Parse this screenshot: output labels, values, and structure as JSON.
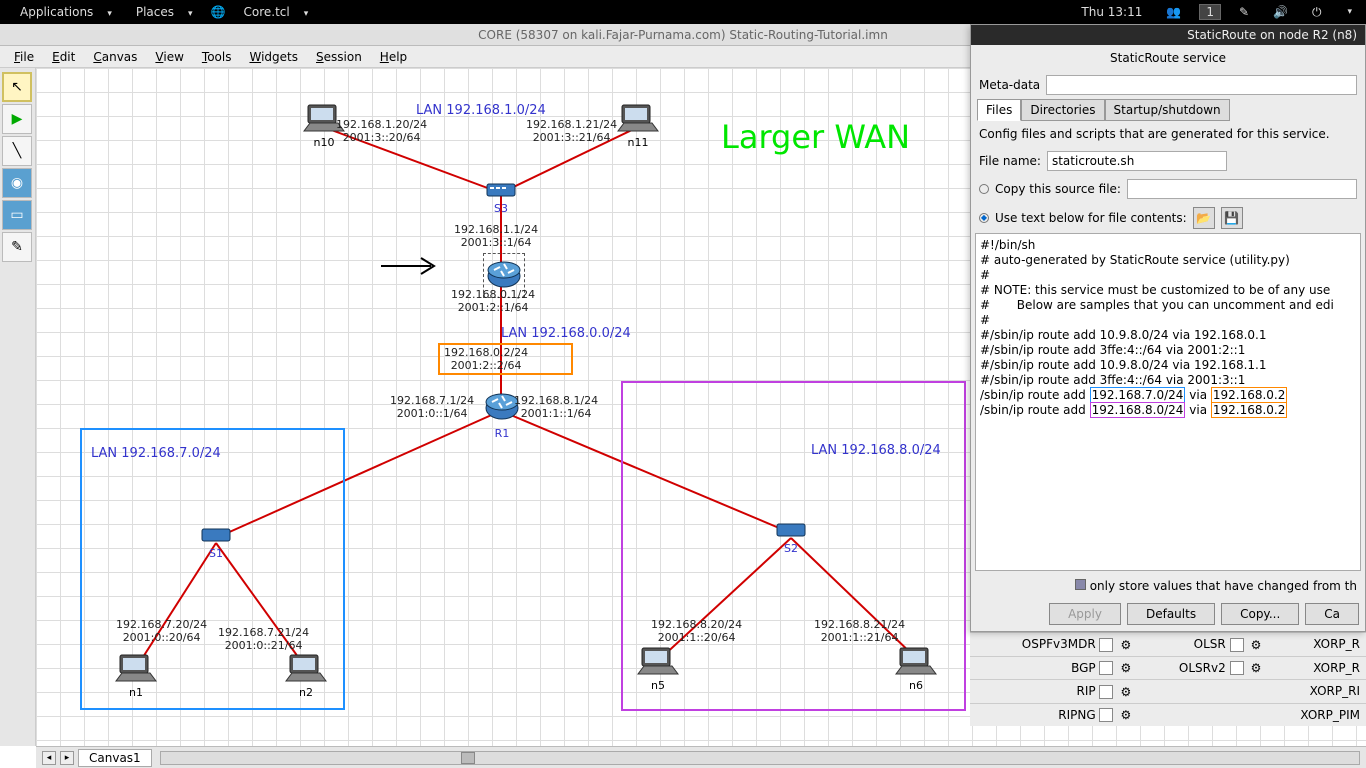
{
  "osbar": {
    "apps": "Applications",
    "places": "Places",
    "app": "Core.tcl",
    "clock": "Thu 13:11",
    "ws": "1"
  },
  "window_title": "CORE (58307 on kali.Fajar-Purnama.com) Static-Routing-Tutorial.imn",
  "menu": [
    "File",
    "Edit",
    "Canvas",
    "View",
    "Tools",
    "Widgets",
    "Session",
    "Help"
  ],
  "tab_label": "Canvas1",
  "big_text": "Larger WAN",
  "lan_labels": {
    "top": "LAN 192.168.1.0/24",
    "mid": "LAN 192.168.0.0/24",
    "left": "LAN 192.168.7.0/24",
    "right": "LAN 192.168.8.0/24"
  },
  "nodes": {
    "n10": "n10",
    "n11": "n11",
    "s3": "S3",
    "r2": "R2",
    "r1": "R1",
    "s1": "S1",
    "s2": "S2",
    "n1": "n1",
    "n2": "n2",
    "n5": "n5",
    "n6": "n6"
  },
  "ips": {
    "n10": "192.168.1.20/24\n2001:3::20/64",
    "n11": "192.168.1.21/24\n2001:3::21/64",
    "r2_top": "192.168.1.1/24\n2001:3::1/64",
    "r2_bot": "192.168.0.1/24\n2001:2::1/64",
    "r1_top": "192.168.0.2/24\n2001:2::2/64",
    "r1_l": "192.168.7.1/24\n2001:0::1/64",
    "r1_r": "192.168.8.1/24\n2001:1::1/64",
    "n1": "192.168.7.20/24\n2001:0::20/64",
    "n2": "192.168.7.21/24\n2001:0::21/64",
    "n5": "192.168.8.20/24\n2001:1::20/64",
    "n6": "192.168.8.21/24\n2001:1::21/64"
  },
  "dialog": {
    "title": "StaticRoute on node R2 (n8)",
    "subtitle": "StaticRoute service",
    "meta_label": "Meta-data",
    "tabs": [
      "Files",
      "Directories",
      "Startup/shutdown"
    ],
    "desc": "Config files and scripts that are generated for this service.",
    "filename_label": "File name:",
    "filename": "staticroute.sh",
    "copy_label": "Copy this source file:",
    "usetext_label": "Use text below for file contents:",
    "script_pre": "#!/bin/sh\n# auto-generated by StaticRoute service (utility.py)\n#\n# NOTE: this service must be customized to be of any use\n#       Below are samples that you can uncomment and edi\n#\n#/sbin/ip route add 10.9.8.0/24 via 192.168.0.1\n#/sbin/ip route add 3ffe:4::/64 via 2001:2::1\n#/sbin/ip route add 10.9.8.0/24 via 192.168.1.1\n#/sbin/ip route add 3ffe:4::/64 via 2001:3::1",
    "route1_a": "/sbin/ip route add ",
    "route1_net": "192.168.7.0/24",
    "route1_b": " via ",
    "route1_gw": "192.168.0.2",
    "route2_a": "/sbin/ip route add ",
    "route2_net": "192.168.8.0/24",
    "route2_b": " via ",
    "route2_gw": "192.168.0.2",
    "store_label": "only store values that have changed from th",
    "btn_apply": "Apply",
    "btn_defaults": "Defaults",
    "btn_copy": "Copy...",
    "btn_cancel": "Ca"
  },
  "services": {
    "c1": [
      "OSPFv3MDR",
      "BGP",
      "RIP",
      "RIPNG"
    ],
    "c2": [
      "OLSR",
      "OLSRv2",
      "",
      ""
    ],
    "c3": [
      "XORP_R",
      "XORP_R",
      "XORP_RI",
      "XORP_PIM"
    ]
  }
}
